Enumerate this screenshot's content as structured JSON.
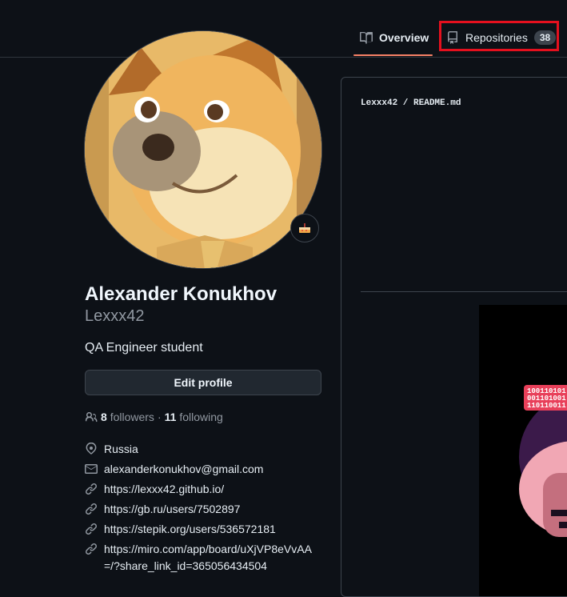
{
  "nav": {
    "overview_label": "Overview",
    "repositories_label": "Repositories",
    "repositories_count": "38"
  },
  "profile": {
    "name": "Alexander Konukhov",
    "login": "Lexxx42",
    "bio": "QA Engineer student",
    "edit_button": "Edit profile",
    "followers_count": "8",
    "followers_label": "followers",
    "separator": "·",
    "following_count": "11",
    "following_label": "following",
    "status_emoji": "cake-icon",
    "location": "Russia",
    "email": "alexanderkonukhov@gmail.com",
    "links": [
      "https://lexxx42.github.io/",
      "https://gb.ru/users/7502897",
      "https://stepik.org/users/536572181",
      "https://miro.com/app/board/uXjVP8eVvAA=/?share_link_id=365056434504"
    ]
  },
  "readme": {
    "path": "Lexxx42 / README.md",
    "banner_bits": [
      "100110101",
      "001101001",
      "110110011"
    ]
  },
  "colors": {
    "background": "#0d1117",
    "accent_underline": "#f78166",
    "highlight_box": "#e5101e",
    "muted_text": "#9198a1"
  }
}
